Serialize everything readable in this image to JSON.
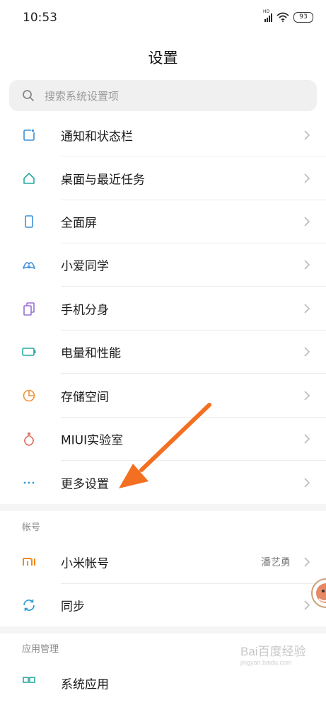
{
  "status_bar": {
    "time": "10:53",
    "network": "HD",
    "battery": "93"
  },
  "header": {
    "title": "设置"
  },
  "search": {
    "placeholder": "搜索系统设置项"
  },
  "settings": {
    "notifications": "通知和状态栏",
    "home_screen": "桌面与最近任务",
    "full_screen": "全面屏",
    "xiaoai": "小爱同学",
    "dual_apps": "手机分身",
    "battery": "电量和性能",
    "storage": "存储空间",
    "miui_lab": "MIUI实验室",
    "more_settings": "更多设置"
  },
  "account_section": {
    "header": "帐号",
    "mi_account": "小米帐号",
    "mi_account_user": "潘艺勇",
    "sync": "同步"
  },
  "apps_section": {
    "header": "应用管理",
    "system_apps": "系统应用"
  },
  "watermark": {
    "text": "Bai百度经验",
    "sub": "jingyan.baidu.com"
  },
  "colors": {
    "notifications_icon": "#3b8fd9",
    "home_icon": "#2aa8a0",
    "fullscreen_icon": "#3b8fd9",
    "xiaoai_icon": "#3b8fd9",
    "dual_icon": "#9b6fd6",
    "battery_icon": "#2aa8a0",
    "storage_icon": "#f2923c",
    "lab_icon": "#e0604e",
    "more_icon": "#2a9ad6",
    "mi_icon": "#f08a1c",
    "sync_icon": "#2a9ad6",
    "arrow": "#f36f21"
  }
}
